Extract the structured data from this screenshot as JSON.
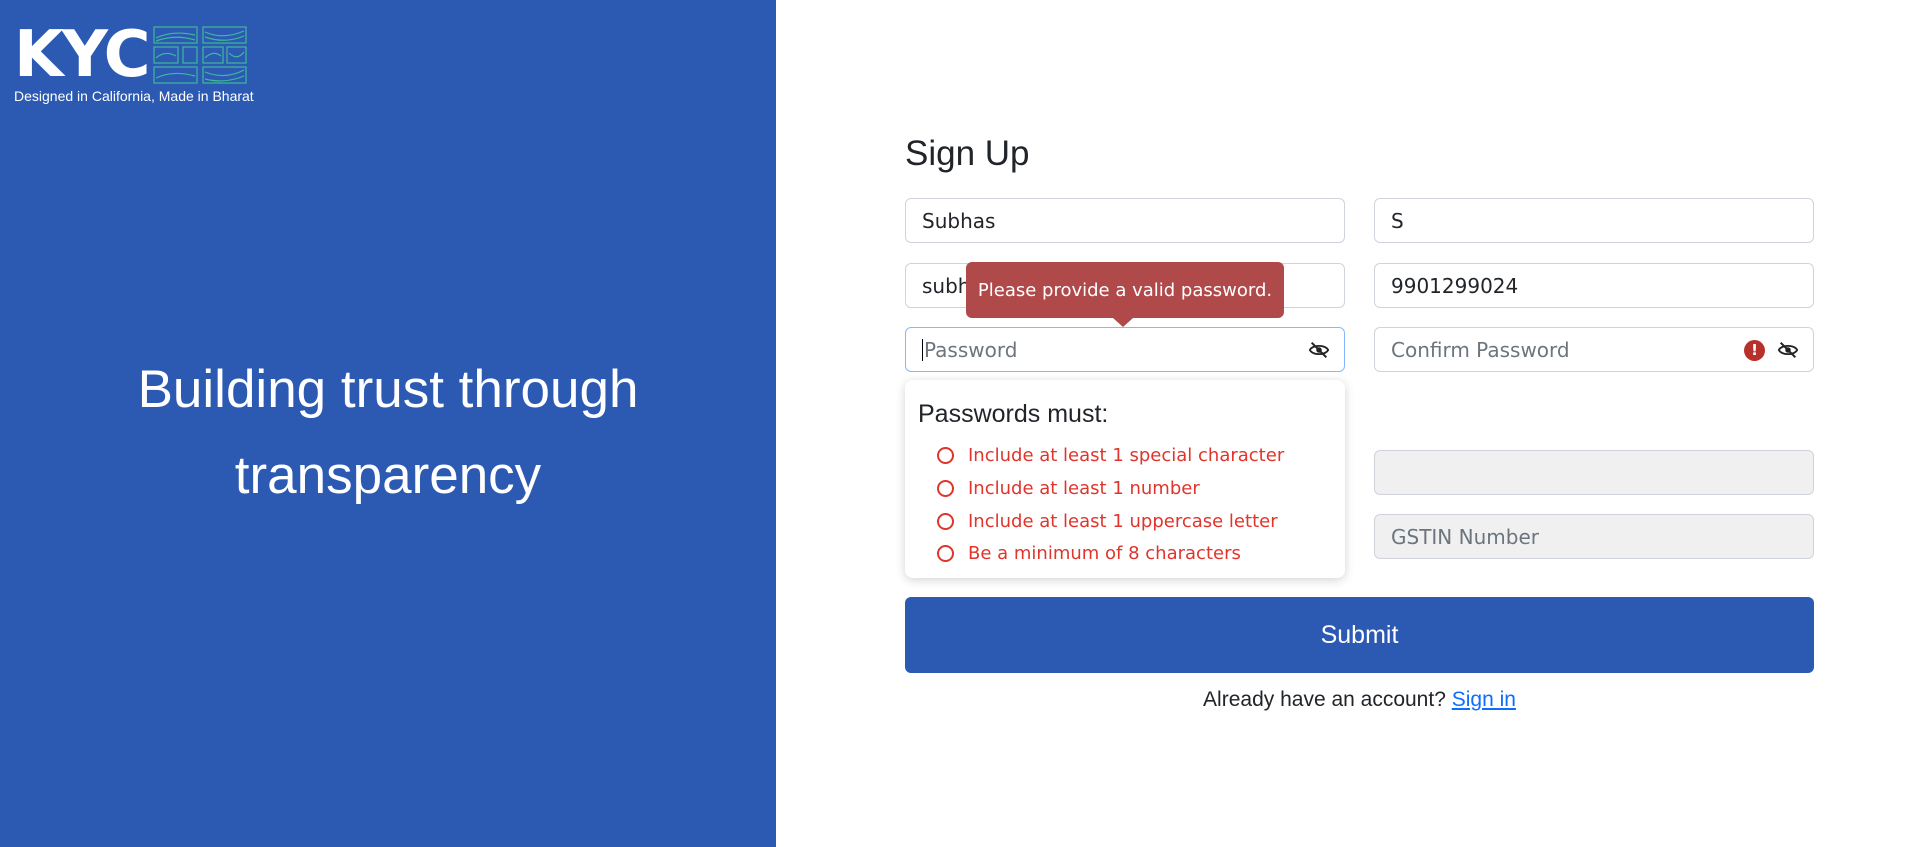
{
  "brand": {
    "logo_text": "KYC",
    "tagline": "Designed in California, Made in Bharat",
    "headline_line1": "Building trust through",
    "headline_line2": "transparency"
  },
  "form": {
    "title": "Sign Up",
    "first_name": "Subhas",
    "last_name": "S",
    "email_visible": "subh",
    "phone": "9901299024",
    "password_placeholder": "Password",
    "confirm_password_placeholder": "Confirm Password",
    "gstin_placeholder": "GSTIN Number",
    "submit_label": "Submit",
    "signin_prompt": "Already have an account?",
    "signin_link": "Sign in"
  },
  "validation": {
    "tooltip": "Please provide a valid password.",
    "rules_title": "Passwords must:",
    "rules": [
      "Include at least 1 special character",
      "Include at least 1 number",
      "Include at least 1 uppercase letter",
      "Be a minimum of 8 characters"
    ]
  },
  "icons": {
    "eye": "eye-slash-icon",
    "error": "exclamation-circle-icon"
  },
  "colors": {
    "brand_blue": "#2c5ab3",
    "error_red": "#e0342c",
    "tooltip_bg": "#b0494a",
    "logo_accent": "#3fb89b",
    "link": "#0d6efd"
  }
}
